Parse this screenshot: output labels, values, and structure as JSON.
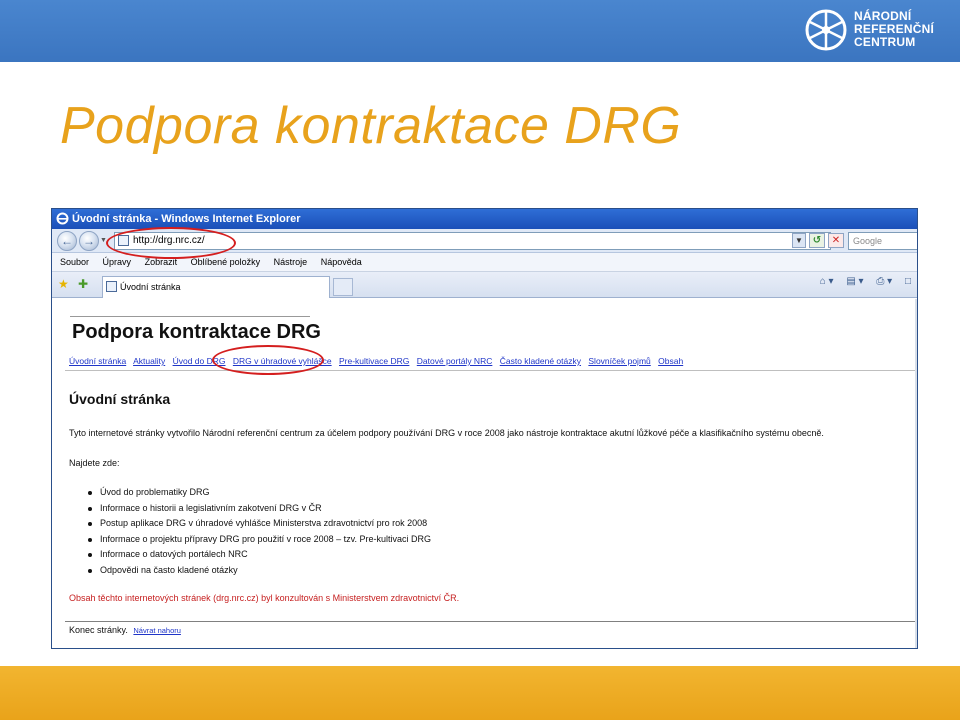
{
  "slide": {
    "title": "Podpora kontraktace DRG",
    "logo_text": "NÁRODNÍ\nREFERENČNÍ\nCENTRUM",
    "colors": {
      "header_blue": "#3b75c0",
      "title_orange": "#e8a21c",
      "footer_orange": "#e9a31a",
      "annotation_red": "#d41e1e"
    }
  },
  "browser": {
    "window_title": "Úvodní stránka - Windows Internet Explorer",
    "address": "http://drg.nrc.cz/",
    "search_placeholder": "Google",
    "menu": [
      "Soubor",
      "Úpravy",
      "Zobrazit",
      "Oblíbené položky",
      "Nástroje",
      "Nápověda"
    ],
    "tab_title": "Úvodní stránka",
    "icons": [
      "back-icon",
      "forward-icon",
      "refresh-icon",
      "stop-icon",
      "favorites-star-icon",
      "add-favorite-icon",
      "home-icon",
      "feeds-icon",
      "print-icon",
      "page-icon"
    ]
  },
  "page": {
    "site_title": "Podpora kontraktace DRG",
    "nav": [
      "Úvodní stránka",
      "Aktuality",
      "Úvod do DRG",
      "DRG v úhradové vyhlášce",
      "Pre-kultivace DRG",
      "Datové portály NRC",
      "Často kladené otázky",
      "Slovníček pojmů",
      "Obsah"
    ],
    "heading": "Úvodní stránka",
    "intro": "Tyto internetové stránky vytvořilo Národní referenční centrum za účelem podpory používání DRG v roce 2008 jako nástroje kontraktace akutní lůžkové péče a klasifikačního systému obecně.",
    "find_here": "Najdete zde:",
    "bullets": [
      "Úvod do problematiky DRG",
      "Informace o historii a legislativním zakotvení DRG v ČR",
      "Postup aplikace DRG v úhradové vyhlášce Ministerstva zdravotnictví pro rok 2008",
      "Informace o projektu přípravy DRG pro použití v roce 2008 – tzv. Pre-kultivaci DRG",
      "Informace o datových portálech NRC",
      "Odpovědi na často kladené otázky"
    ],
    "consult_note": "Obsah těchto internetových stránek (drg.nrc.cz) byl konzultován s Ministerstvem zdravotnictví ČR.",
    "footer_text": "Konec stránky.",
    "back_to_top": "Návrat nahoru"
  }
}
